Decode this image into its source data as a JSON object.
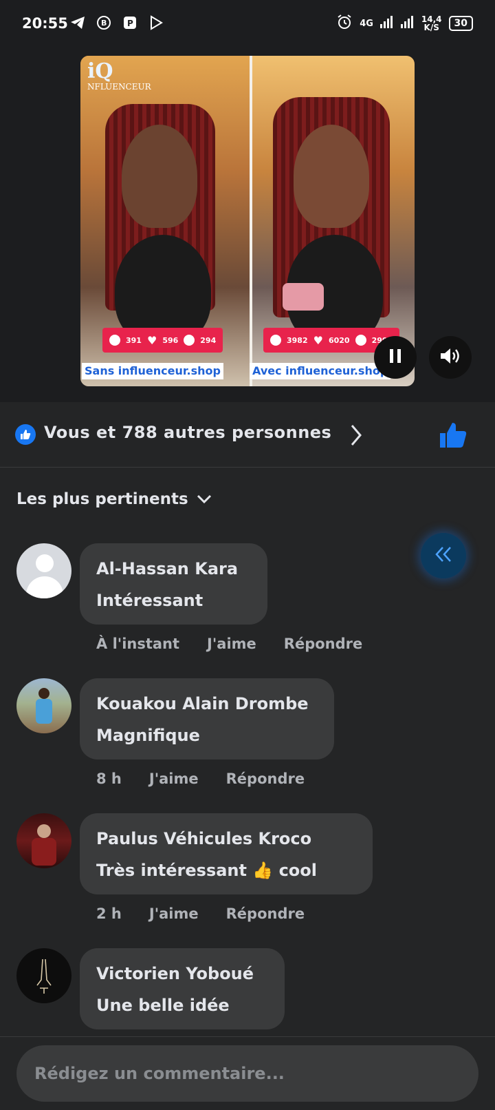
{
  "status_bar": {
    "time": "20:55",
    "network": "4G",
    "speed_value": "14,4",
    "speed_unit": "K/S",
    "battery": "30",
    "left_icons": [
      "telegram-icon",
      "b-icon",
      "p-icon",
      "play-store-icon"
    ],
    "right_icons": [
      "alarm-icon",
      "signal-icon",
      "signal-icon"
    ]
  },
  "video": {
    "logo_text": "NFLUENCEUR",
    "left_stats": [
      "391",
      "596",
      "294"
    ],
    "right_stats": [
      "3982",
      "6020",
      "2997"
    ],
    "left_caption": "Sans influenceur.shop",
    "right_caption": "Avec influenceur.shop",
    "controls": [
      "pause-icon",
      "volume-icon"
    ]
  },
  "reactions": {
    "text": "Vous et 788 autres personnes"
  },
  "sort": {
    "label": "Les plus pertinents"
  },
  "comments": [
    {
      "name": "Al-Hassan Kara",
      "text": "Intéressant",
      "time": "À l'instant",
      "like": "J'aime",
      "reply": "Répondre"
    },
    {
      "name": "Kouakou Alain Drombe",
      "text": "Magnifique",
      "time": "8 h",
      "like": "J'aime",
      "reply": "Répondre"
    },
    {
      "name": "Paulus Véhicules Kroco",
      "text": "Très intéressant 👍 cool",
      "time": "2 h",
      "like": "J'aime",
      "reply": "Répondre"
    },
    {
      "name": "Victorien Yoboué",
      "text": "Une belle idée"
    }
  ],
  "composer": {
    "placeholder": "Rédigez un commentaire..."
  },
  "colors": {
    "background": "#242526",
    "bubble": "#3a3b3c",
    "accent": "#1877f2"
  }
}
